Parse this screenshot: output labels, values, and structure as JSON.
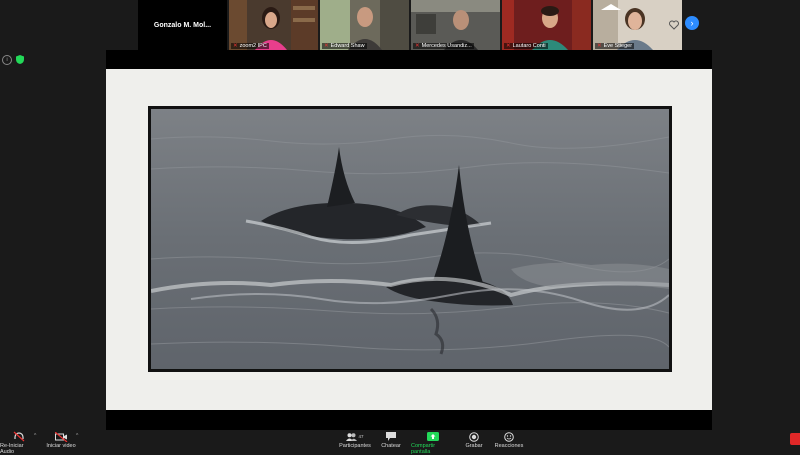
{
  "gallery": {
    "first_tile_name": "Gonzalo M. Mol...",
    "participants": [
      {
        "name": "zoom2 IPC"
      },
      {
        "name": "Edward Shaw"
      },
      {
        "name": "Mercedes Usandiz..."
      },
      {
        "name": "Lautaro Conti"
      },
      {
        "name": "Eve Stieger"
      }
    ],
    "next_icon": "chevron-right-icon"
  },
  "toolbar": {
    "audio_label": "Re-Iniciar Audio",
    "video_label": "Iniciar video",
    "participants_label": "Participantes",
    "participants_count": "47",
    "chat_label": "Chatear",
    "share_label": "Compartir pantalla",
    "record_label": "Grabar",
    "reactions_label": "Reacciones"
  },
  "colors": {
    "background": "#1a1a1a",
    "accent": "#2d8cff",
    "share_green": "#23d959",
    "mute_red": "#e33333"
  }
}
